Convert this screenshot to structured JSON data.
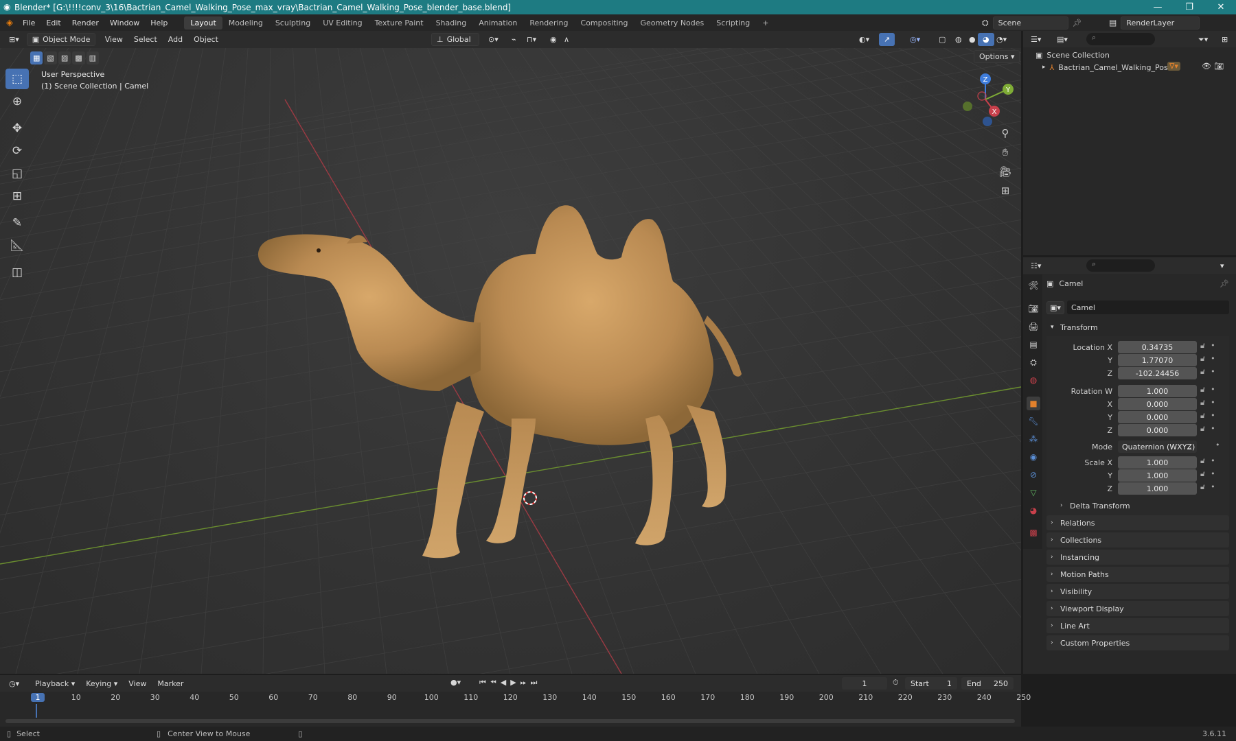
{
  "window": {
    "title": "Blender* [G:\\!!!!conv_3\\16\\Bactrian_Camel_Walking_Pose_max_vray\\Bactrian_Camel_Walking_Pose_blender_base.blend]"
  },
  "menubar": {
    "menus": [
      "File",
      "Edit",
      "Render",
      "Window",
      "Help"
    ],
    "workspaces": [
      "Layout",
      "Modeling",
      "Sculpting",
      "UV Editing",
      "Texture Paint",
      "Shading",
      "Animation",
      "Rendering",
      "Compositing",
      "Geometry Nodes",
      "Scripting"
    ],
    "active_workspace": "Layout",
    "add_tab": "+",
    "scene": "Scene",
    "view_layer": "RenderLayer"
  },
  "viewport_header": {
    "mode": "Object Mode",
    "menus": [
      "View",
      "Select",
      "Add",
      "Object"
    ],
    "orientation": "Global",
    "options": "Options"
  },
  "viewport": {
    "perspective": "User Perspective",
    "collection_info": "(1) Scene Collection | Camel",
    "gizmo": {
      "x": "X",
      "y": "Y",
      "z": "Z"
    },
    "colors": {
      "x_axis": "#c8404b",
      "y_axis": "#7fac36",
      "z_axis": "#3f7ddc"
    }
  },
  "outliner": {
    "root": "Scene Collection",
    "items": [
      {
        "label": "Bactrian_Camel_Walking_Pose"
      }
    ]
  },
  "properties": {
    "object_name": "Camel",
    "data_name": "Camel",
    "transform_header": "Transform",
    "location_label": "Location X",
    "location": {
      "x": "0.34735",
      "y": "1.77070",
      "z": "-102.24456"
    },
    "rotation_label": "Rotation W",
    "rotation": {
      "w": "1.000",
      "x": "0.000",
      "y": "0.000",
      "z": "0.000"
    },
    "mode_label": "Mode",
    "mode_value": "Quaternion (WXYZ)",
    "scale_label": "Scale X",
    "scale": {
      "x": "1.000",
      "y": "1.000",
      "z": "1.000"
    },
    "axis_labels": {
      "x": "X",
      "y": "Y",
      "z": "Z"
    },
    "delta_transform": "Delta Transform",
    "panels": [
      "Relations",
      "Collections",
      "Instancing",
      "Motion Paths",
      "Visibility",
      "Viewport Display",
      "Line Art",
      "Custom Properties"
    ],
    "accent_color": "#e3812c"
  },
  "timeline": {
    "menus": [
      "Playback",
      "Keying",
      "View",
      "Marker"
    ],
    "current_frame": "1",
    "start_label": "Start",
    "start": "1",
    "end_label": "End",
    "end": "250",
    "ruler": [
      "1",
      "10",
      "20",
      "30",
      "40",
      "50",
      "60",
      "70",
      "80",
      "90",
      "100",
      "110",
      "120",
      "130",
      "140",
      "150",
      "160",
      "170",
      "180",
      "190",
      "200",
      "210",
      "220",
      "230",
      "240",
      "250"
    ],
    "playhead_color": "#4772b3"
  },
  "statusbar": {
    "left": "Select",
    "middle": "Center View to Mouse",
    "version": "3.6.11"
  }
}
